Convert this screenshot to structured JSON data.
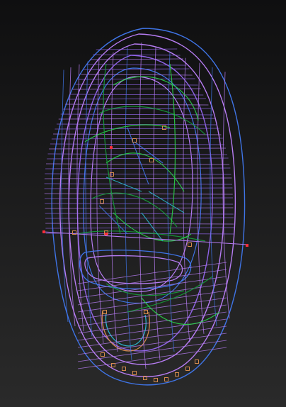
{
  "viewport": {
    "background_top": "#0f0f10",
    "background_bottom": "#2a2a2a",
    "colors": {
      "wire_purple": "#b67cf2",
      "wire_violet": "#8f63e6",
      "wire_blue": "#3f74e6",
      "wire_cyan": "#2ab2c8",
      "wire_green": "#2ad04a",
      "wire_dark_green": "#169d3c",
      "marker_orange": "#d48a4d",
      "marker_red": "#ff2d3a"
    },
    "model": "mouse-shell-wireframe"
  }
}
